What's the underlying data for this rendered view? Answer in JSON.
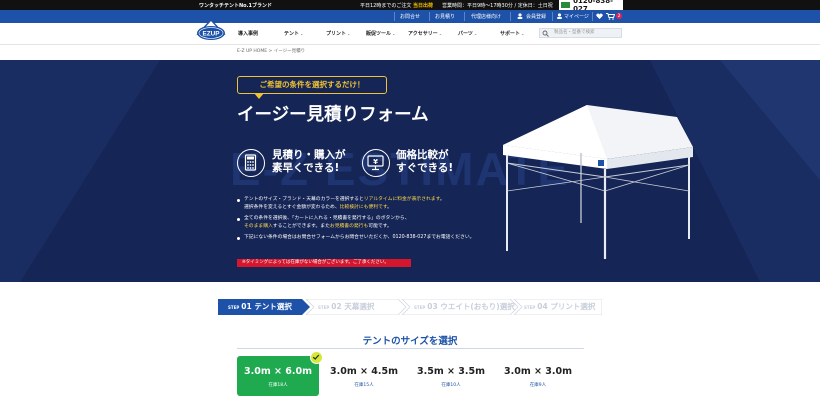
{
  "topbar": {
    "brand": "ワンタッチテントNo.1ブランド",
    "ship_prefix": "平日12時までのご注文",
    "ship_highlight": "当日出荷",
    "hours": "営業時間：平日9時〜17時30分 / 定休日：土日祝",
    "phone": "0120-838-027"
  },
  "subbar": {
    "contact": "お問合せ",
    "quote": "お見積り",
    "agency": "代理店様向け",
    "register": "会員登録",
    "mypage": "マイページ",
    "cart_count": "2"
  },
  "logo": {
    "text": "EZUP"
  },
  "nav": {
    "items": [
      {
        "label": "導入事例",
        "chevron": false
      },
      {
        "label": "テント",
        "chevron": true
      },
      {
        "label": "プリント",
        "chevron": true
      },
      {
        "label": "販促ツール",
        "chevron": true
      },
      {
        "label": "アクセサリー",
        "chevron": true
      },
      {
        "label": "パーツ",
        "chevron": true
      },
      {
        "label": "サポート",
        "chevron": true
      }
    ],
    "search_placeholder": "製品名・型番で検索"
  },
  "breadcrumb": "E-Z UP HOME > イージー見積り",
  "hero": {
    "bg_text": "E-Z ESTIMATE",
    "pill": "ご希望の条件を選択するだけ！",
    "title": "イージー見積りフォーム",
    "feature1": {
      "line1": "見積り・購入が",
      "line2": "素早くできる!",
      "icon": "calculator-icon"
    },
    "feature2": {
      "line1": "価格比較が",
      "line2": "すぐできる!",
      "icon": "yen-monitor-icon"
    },
    "bullet1_a": "テントのサイズ・ブランド・天幕のカラーを選択すると",
    "bullet1_hl": "リアルタイムに料金が表示されます",
    "bullet1_b": "。",
    "bullet1_c": "選択条件を変えるとすぐ金額が変わるため、",
    "bullet1_hl2": "比較検討にも便利です",
    "bullet1_d": "。",
    "bullet2_a": "全ての条件を選択後、「カートに入れる・見積書を発行する」のボタンから、",
    "bullet2_hl": "そのまま購入",
    "bullet2_b": "することができます。また",
    "bullet2_hl2": "お見積書の発行も",
    "bullet2_c": "可能です。",
    "bullet3": "下記にない条件の場合はお問合せフォームからお問合せいただくか、0120-838-027までお電話ください。",
    "warning": "※タイミングによっては在庫がない場合がございます。ご了承ください。"
  },
  "steps": [
    {
      "num_label": "STEP",
      "num": "01",
      "label": "テント選択",
      "active": true
    },
    {
      "num_label": "STEP",
      "num": "02",
      "label": "天幕選択",
      "active": false
    },
    {
      "num_label": "STEP",
      "num": "03",
      "label": "ウエイト(おもり)選択",
      "active": false
    },
    {
      "num_label": "STEP",
      "num": "04",
      "label": "プリント選択",
      "active": false
    }
  ],
  "section_title": "テントのサイズを選択",
  "sizes": [
    {
      "dim": "3.0m × 6.0m",
      "count": "在庫18人",
      "selected": true
    },
    {
      "dim": "3.0m × 4.5m",
      "count": "在庫15人",
      "selected": false
    },
    {
      "dim": "3.5m × 3.5m",
      "count": "在庫10人",
      "selected": false
    },
    {
      "dim": "3.0m × 3.0m",
      "count": "在庫9人",
      "selected": false
    }
  ],
  "colors": {
    "brand_blue": "#1d52a8",
    "hero_navy": "#152555",
    "accent_yellow": "#f1c232",
    "selected_green": "#1faa4f",
    "warning_red": "#d5162d"
  }
}
